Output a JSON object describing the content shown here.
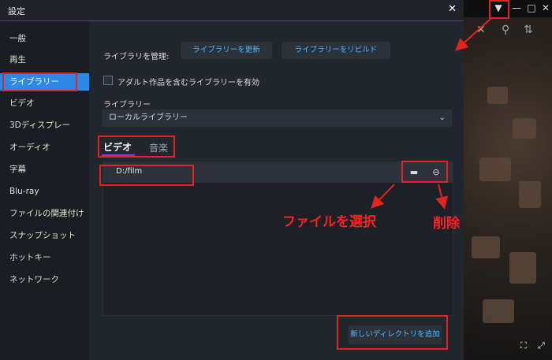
{
  "dialog": {
    "title": "設定",
    "close_icon": "close-icon"
  },
  "sidebar": {
    "items": [
      {
        "label": "一般"
      },
      {
        "label": "再生"
      },
      {
        "label": "ライブラリー",
        "active": true
      },
      {
        "label": "ビデオ"
      },
      {
        "label": "3Dディスプレー"
      },
      {
        "label": "オーディオ"
      },
      {
        "label": "字幕"
      },
      {
        "label": "Blu-ray"
      },
      {
        "label": "ファイルの関連付け"
      },
      {
        "label": "スナップショット"
      },
      {
        "label": "ホットキー"
      },
      {
        "label": "ネットワーク"
      }
    ]
  },
  "library": {
    "manage_label": "ライブラリを管理:",
    "update_button": "ライブラリーを更新",
    "rebuild_button": "ライブラリーをリビルド",
    "adult_checkbox_label": "アダルト作品を含むライブラリーを有効",
    "library_label": "ライブラリー",
    "library_select_value": "ローカルライブラリー",
    "tabs": [
      {
        "label": "ビデオ"
      },
      {
        "label": "音楽"
      }
    ],
    "directories": [
      {
        "path": "D:/film"
      }
    ],
    "add_directory_button": "新しいディレクトリを追加"
  },
  "annotations": {
    "select_file": "ファイルを選択",
    "delete": "削除"
  },
  "colors": {
    "accent": "#2e89e6",
    "tab_underline": "#7b4bd1",
    "link": "#51b3ff",
    "annotation": "#e52222"
  }
}
